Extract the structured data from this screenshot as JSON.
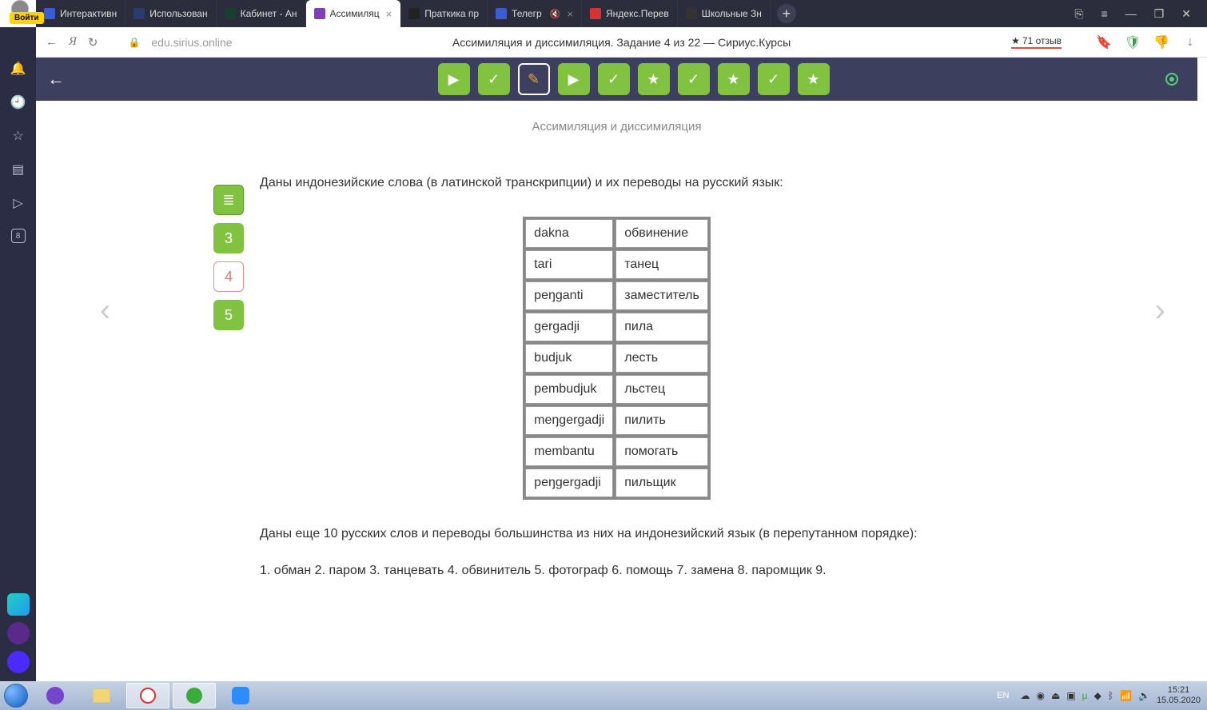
{
  "login_label": "Войти",
  "tabs": [
    {
      "label": "Интерактивн"
    },
    {
      "label": "Использован"
    },
    {
      "label": "Кабинет - Ан"
    },
    {
      "label": "Ассимиляц"
    },
    {
      "label": "Праткика пр"
    },
    {
      "label": "Телегр"
    },
    {
      "label": "Яндекс.Перев"
    },
    {
      "label": "Школьные Зн"
    }
  ],
  "url": "edu.sirius.online",
  "page_title": "Ассимиляция и диссимиляция. Задание 4 из 22 — Сириус.Курсы",
  "rating_star": "★",
  "rating_text": "71 отзыв",
  "section_title": "Ассимиляция и диссимиляция",
  "intro": "Даны индонезийские слова (в латинской транскрипции) и их переводы на русский язык:",
  "tasknav": {
    "n3": "3",
    "n4": "4",
    "n5": "5"
  },
  "table_rows": [
    {
      "a": "dakna",
      "b": "обвинение"
    },
    {
      "a": "tari",
      "b": "танец"
    },
    {
      "a": "peŋganti",
      "b": "заместитель"
    },
    {
      "a": "gergadji",
      "b": "пила"
    },
    {
      "a": "budjuk",
      "b": "лесть"
    },
    {
      "a": "pembudjuk",
      "b": "льстец"
    },
    {
      "a": "meŋgergadji",
      "b": "пилить"
    },
    {
      "a": "membantu",
      "b": "помогать"
    },
    {
      "a": "peŋgergadji",
      "b": "пильщик"
    }
  ],
  "outro": "Даны еще 10 русских слов и переводы большинства из них на индонезийский язык (в перепутанном порядке):",
  "cutoff": "1. обман  2. паром  3. танцевать  4. обвинитель  5. фотограф  6. помощь  7. замена  8. паромщик  9.",
  "sidebar_badge": "8",
  "lang": "EN",
  "time": "15:21",
  "date": "15.05.2020"
}
